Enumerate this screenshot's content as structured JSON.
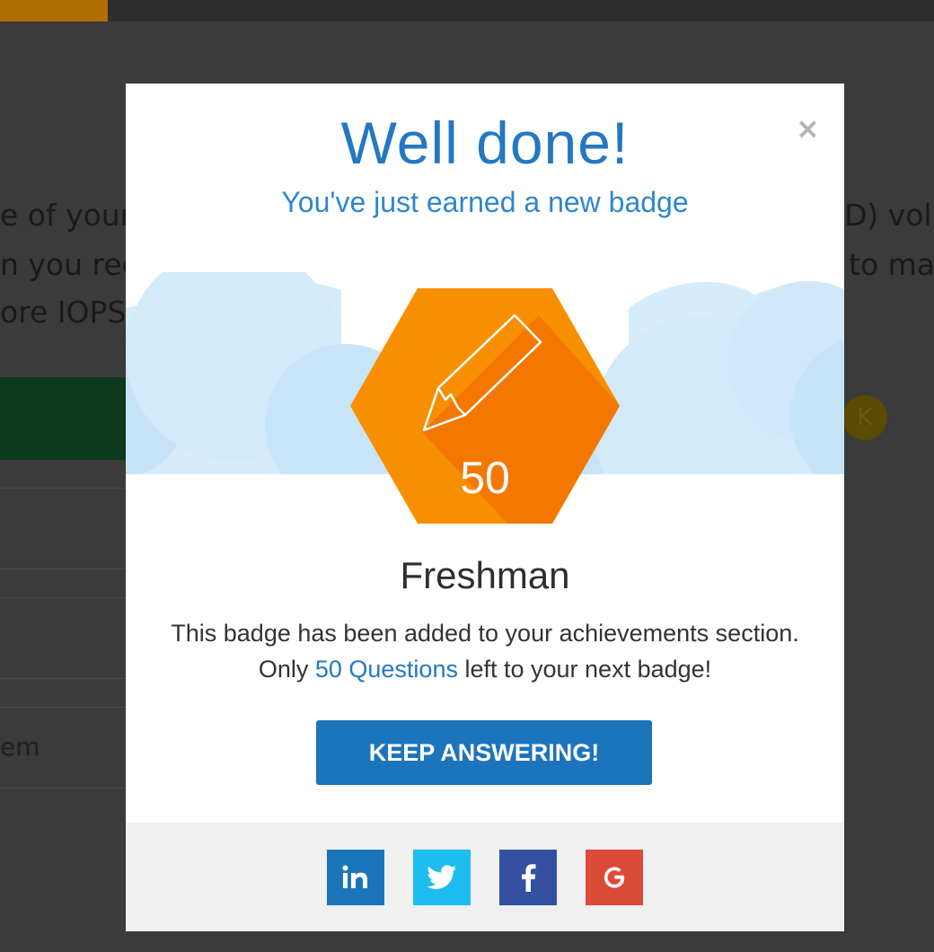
{
  "background": {
    "line1_left": "e of your",
    "line2_left": "n you rec",
    "line3_left": "ore IOPS",
    "line1_right": "D) vol",
    "line2_right": "to ma",
    "row_text": "em",
    "avatar_letter": "K"
  },
  "modal": {
    "close_label": "×",
    "title": "Well done!",
    "subtitle": "You've just earned a new badge",
    "badge": {
      "number": "50",
      "name": "Freshman",
      "color": "#f78f00",
      "shade_color": "#f47800"
    },
    "description_line1": "This badge has been added to your achievements section.",
    "description_pre": "Only ",
    "description_link": "50 Questions",
    "description_post": " left to your next badge!",
    "button_label": "KEEP ANSWERING!",
    "share": [
      {
        "name": "linkedin",
        "label": "in",
        "color": "#1a75bb"
      },
      {
        "name": "twitter",
        "label": "twitter-bird-icon",
        "color": "#1dbcf1"
      },
      {
        "name": "facebook",
        "label": "f",
        "color": "#3450a1"
      },
      {
        "name": "google",
        "label": "G",
        "color": "#dc4a38"
      }
    ]
  }
}
